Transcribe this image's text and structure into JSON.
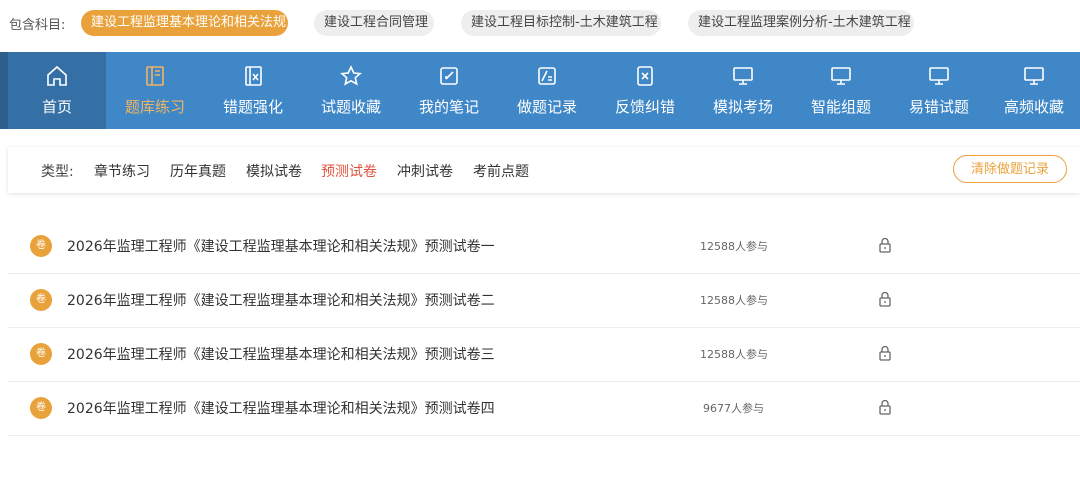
{
  "subjects": {
    "label": "包含科目:",
    "items": [
      {
        "label": "建设工程监理基本理论和相关法规",
        "active": true
      },
      {
        "label": "建设工程合同管理",
        "active": false
      },
      {
        "label": "建设工程目标控制-土木建筑工程",
        "active": false
      },
      {
        "label": "建设工程监理案例分析-土木建筑工程",
        "active": false
      }
    ]
  },
  "nav": {
    "items": [
      {
        "label": "首页",
        "icon": "home-icon"
      },
      {
        "label": "题库练习",
        "icon": "book-icon"
      },
      {
        "label": "错题强化",
        "icon": "wrong-doc-icon"
      },
      {
        "label": "试题收藏",
        "icon": "star-icon"
      },
      {
        "label": "我的笔记",
        "icon": "edit-icon"
      },
      {
        "label": "做题记录",
        "icon": "record-icon"
      },
      {
        "label": "反馈纠错",
        "icon": "feedback-icon"
      },
      {
        "label": "模拟考场",
        "icon": "monitor-icon"
      },
      {
        "label": "智能组题",
        "icon": "monitor-icon"
      },
      {
        "label": "易错试题",
        "icon": "monitor-icon"
      },
      {
        "label": "高频收藏",
        "icon": "monitor-icon"
      }
    ]
  },
  "filter": {
    "type_label": "类型:",
    "types": [
      "章节练习",
      "历年真题",
      "模拟试卷",
      "预测试卷",
      "冲刺试卷",
      "考前点题"
    ],
    "selected": "预测试卷",
    "clear_label": "清除做题记录"
  },
  "papers": [
    {
      "badge": "卷",
      "title": "2026年监理工程师《建设工程监理基本理论和相关法规》预测试卷一",
      "participants": "12588人参与",
      "locked": true
    },
    {
      "badge": "卷",
      "title": "2026年监理工程师《建设工程监理基本理论和相关法规》预测试卷二",
      "participants": "12588人参与",
      "locked": true
    },
    {
      "badge": "卷",
      "title": "2026年监理工程师《建设工程监理基本理论和相关法规》预测试卷三",
      "participants": "12588人参与",
      "locked": true
    },
    {
      "badge": "卷",
      "title": "2026年监理工程师《建设工程监理基本理论和相关法规》预测试卷四",
      "participants": "9677人参与",
      "locked": true
    }
  ],
  "colors": {
    "accent": "#e9a23b",
    "nav": "#3f87c6",
    "nav_home": "#346fa6",
    "selected_type": "#e0533d"
  }
}
